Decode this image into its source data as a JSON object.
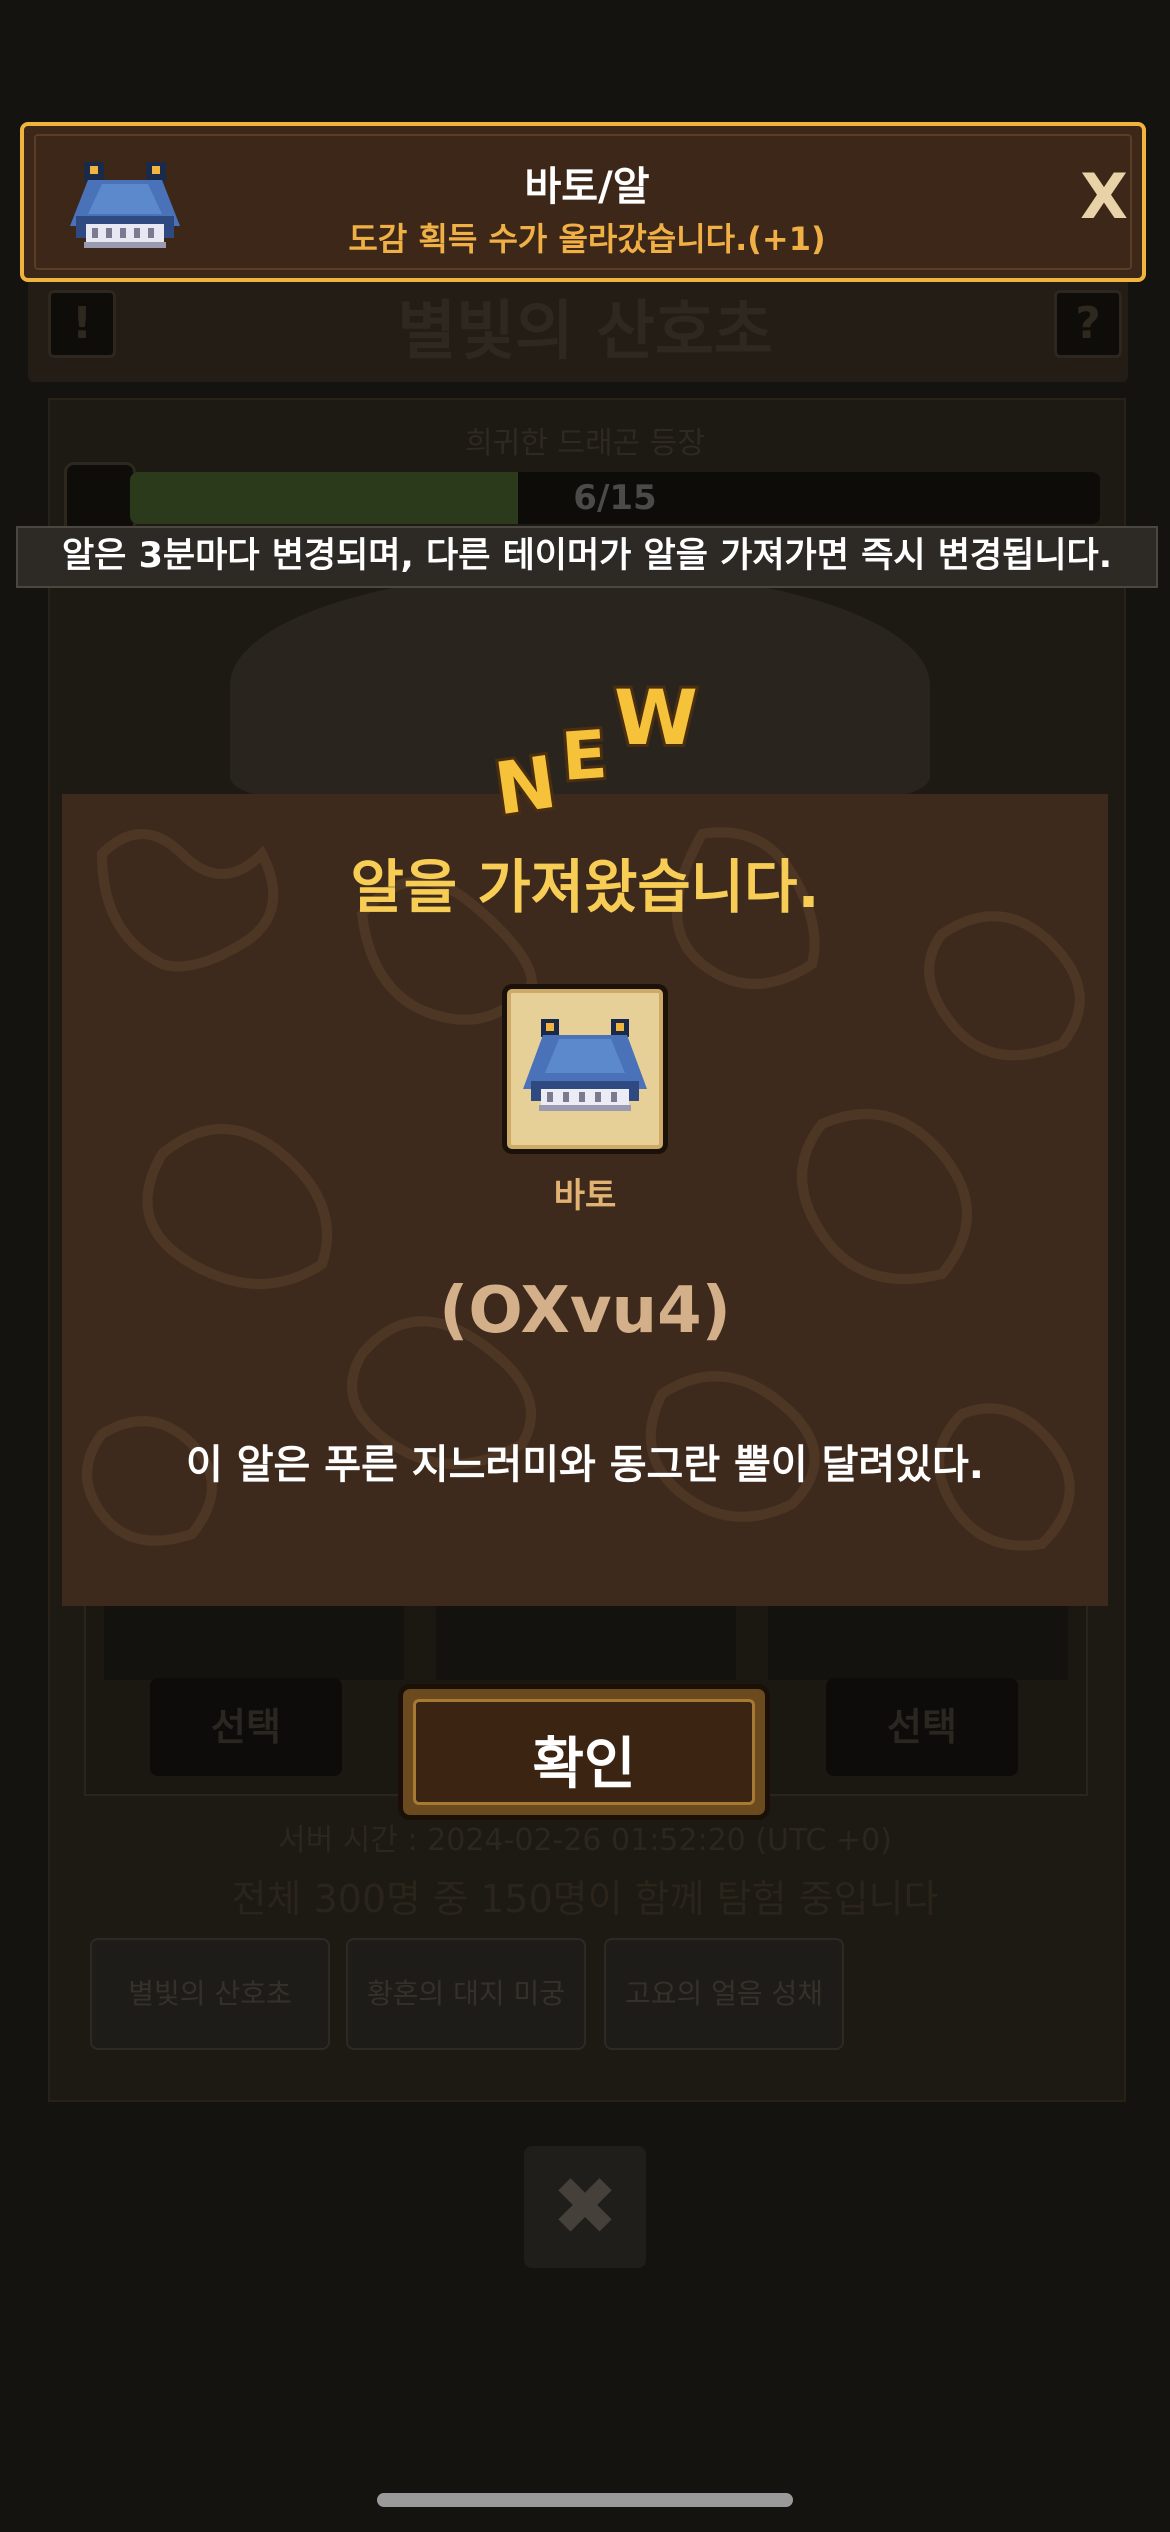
{
  "toast": {
    "title": "바토/알",
    "subtitle": "도감 획득 수가 올라갔습니다.(+1)",
    "close_label": "X",
    "accent_color": "#f0b43c"
  },
  "background": {
    "header_title": "별빛의 산호초",
    "header_left_icon": "!",
    "header_right_icon": "?",
    "subtitle": "희귀한 드래곤 등장",
    "progress_text": "6/15",
    "progress_value": 0.4,
    "select_label": "선택",
    "server_time": "서버 시간 : 2024-02-26 01:52:20 (UTC +0)",
    "player_count": "전체 300명 중 150명이 함께 탐험 중입니다",
    "tabs": [
      "별빛의 산호초",
      "황혼의 대지 미궁",
      "고요의 얼음 성채"
    ],
    "close_icon": "✖"
  },
  "notice": "알은 3분마다 변경되며, 다른 테이머가 알을 가져가면 즉시 변경됩니다.",
  "dialog": {
    "badge": "NEW",
    "title": "알을 가져왔습니다.",
    "item_name": "바토",
    "egg_code": "(OXvu4)",
    "description": "이 알은 푸른 지느러미와 동그란 뿔이 달려있다.",
    "title_color": "#f7cd55"
  },
  "confirm_label": "확인"
}
